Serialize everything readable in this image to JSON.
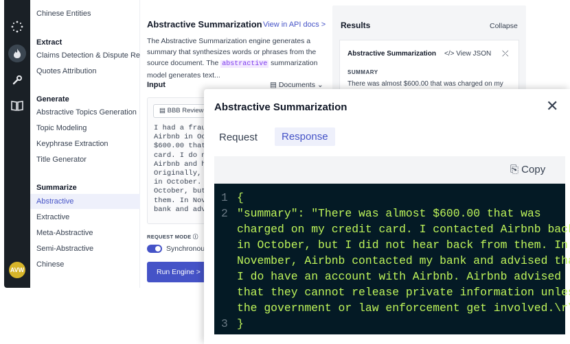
{
  "sidebar": {
    "items": [
      {
        "label": "Chinese Entities"
      },
      {
        "label": "Extract",
        "heading": true
      },
      {
        "label": "Claims Detection & Dispute Re..."
      },
      {
        "label": "Quotes Attribution"
      },
      {
        "label": "Generate",
        "heading": true
      },
      {
        "label": "Abstractive Topics Generation"
      },
      {
        "label": "Topic Modeling"
      },
      {
        "label": "Keyphrase Extraction"
      },
      {
        "label": "Title Generator"
      },
      {
        "label": "Summarize",
        "heading": true
      },
      {
        "label": "Abstractive",
        "active": true
      },
      {
        "label": "Extractive"
      },
      {
        "label": "Meta-Abstractive"
      },
      {
        "label": "Semi-Abstractive"
      },
      {
        "label": "Chinese"
      }
    ]
  },
  "rail": {
    "icons": [
      "sparkle-icon",
      "fire-icon",
      "wrench-icon",
      "book-icon"
    ],
    "avatar": "AVW",
    "avatar_color": "#d7b52a"
  },
  "main": {
    "title": "Abstractive Summarization",
    "api_link": "View in API docs >",
    "desc_before": "The Abstractive Summarization engine generates a summary that synthesizes words or phrases from the source document. The ",
    "desc_code": "abstractive",
    "desc_after": " summarization model generates text...",
    "input_label": "Input",
    "documents_label": "Documents",
    "doc_tag": "BBB Review",
    "input_text": "I had a fraud\nAirbnb in Oct\n$600.00 that\ncard. I do no\nAirbnb and ha\nOriginally, I\nin October. I\nOctober, but\nthem. In Nove\nbank and advi",
    "request_mode_label": "REQUEST MODE",
    "sync_label": "Synchronous",
    "run_label": "Run Engine >"
  },
  "results": {
    "title": "Results",
    "collapse": "Collapse",
    "card_title": "Abstractive Summarization",
    "view_json": "View JSON",
    "summary_label": "SUMMARY",
    "summary_text": "There was almost $600.00 that was charged on my"
  },
  "modal": {
    "title": "Abstractive Summarization",
    "tabs": [
      "Request",
      "Response"
    ],
    "active_tab": "Response",
    "copy_label": "Copy",
    "code": [
      {
        "num": "1",
        "text": "{"
      },
      {
        "num": "2",
        "text": "\"summary\": \"There was almost $600.00 that was"
      },
      {
        "num": "",
        "text": "charged on my credit card. I contacted Airbnb back"
      },
      {
        "num": "",
        "text": "in October, but I did not hear back from them. In"
      },
      {
        "num": "",
        "text": "November, Airbnb contacted my bank and advised that"
      },
      {
        "num": "",
        "text": "I do have an account with Airbnb. Airbnb advised"
      },
      {
        "num": "",
        "text": "that they cannot release private information unless"
      },
      {
        "num": "",
        "text": "the government or law enforcement get involved.\\r\\n\""
      },
      {
        "num": "3",
        "text": "}"
      }
    ]
  },
  "colors": {
    "accent": "#4553c7",
    "code_bg": "#041a25",
    "code_text": "#bff55a",
    "rail_bg": "#1a2026"
  }
}
